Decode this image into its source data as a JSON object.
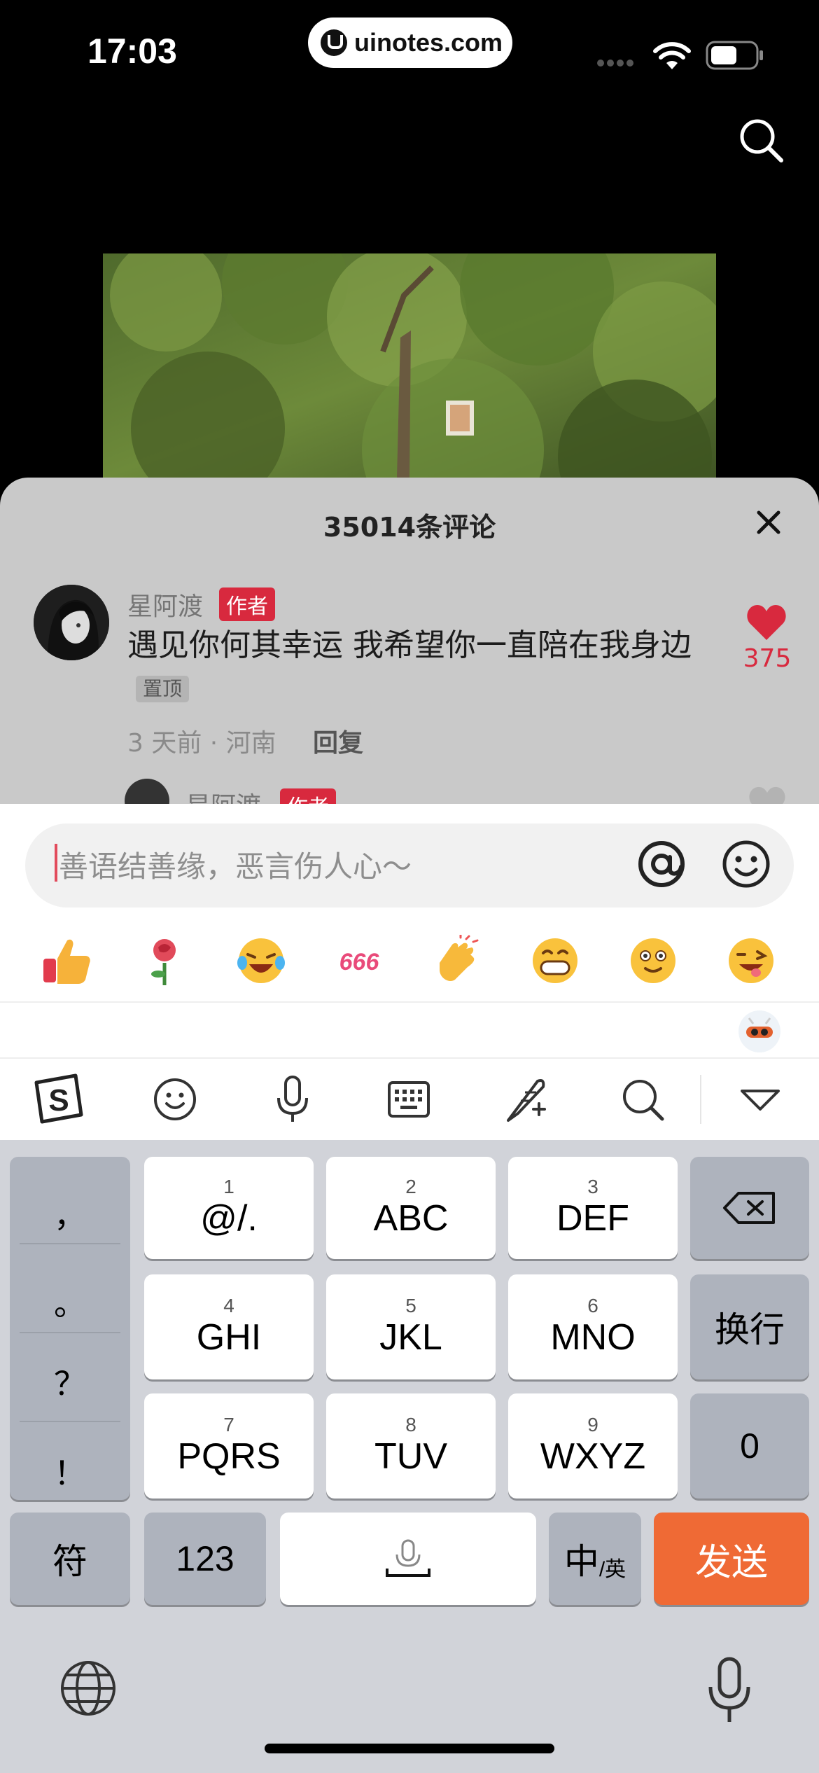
{
  "status_bar": {
    "time": "17:03",
    "url": "uinotes.com"
  },
  "comment_sheet": {
    "title": "35014条评论",
    "comment": {
      "author": "星阿渡",
      "author_badge": "作者",
      "text": "遇见你何其幸运 我希望你一直陪在我身边",
      "pin_label": "置顶",
      "meta": "3 天前 · 河南",
      "reply_label": "回复",
      "like_count": "375",
      "liked": true
    },
    "reply_preview": {
      "author": "星阿渡",
      "author_badge": "作者"
    }
  },
  "input_panel": {
    "placeholder": "善语结善缘，恶言伤人心～",
    "quick_emojis": [
      "thumbs-up-icon",
      "rose-icon",
      "laughing-crying-icon",
      "666-icon",
      "clapping-icon",
      "grin-icon",
      "shy-smile-icon",
      "wink-tongue-icon"
    ]
  },
  "ime_toolbar": {
    "items": [
      "sogou-logo-icon",
      "emoji-icon",
      "voice-icon",
      "keyboard-icon",
      "handwriting-icon",
      "search-icon",
      "collapse-icon"
    ]
  },
  "keyboard": {
    "punctuation": [
      "，",
      "。",
      "？",
      "！"
    ],
    "keys": [
      {
        "num": "1",
        "letters": "@/."
      },
      {
        "num": "2",
        "letters": "ABC"
      },
      {
        "num": "3",
        "letters": "DEF"
      },
      {
        "num": "4",
        "letters": "GHI"
      },
      {
        "num": "5",
        "letters": "JKL"
      },
      {
        "num": "6",
        "letters": "MNO"
      },
      {
        "num": "7",
        "letters": "PQRS"
      },
      {
        "num": "8",
        "letters": "TUV"
      },
      {
        "num": "9",
        "letters": "WXYZ"
      }
    ],
    "newline_label": "换行",
    "zero_label": "0",
    "symbol_label": "符",
    "number_label": "123",
    "lang_main": "中",
    "lang_sub": "/英",
    "send_label": "发送"
  },
  "colors": {
    "accent_red": "#d8293e",
    "send_orange": "#ef6a35",
    "caret_pink": "#e24b5c"
  }
}
